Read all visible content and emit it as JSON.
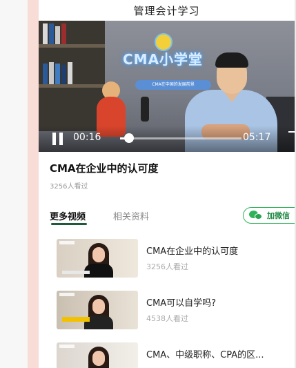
{
  "header": {
    "title": "管理会计学习"
  },
  "video": {
    "sign_text": "CMA小学堂",
    "sign_subtitle": "CMA在中国的发展前景",
    "current_time": "00:16",
    "total_time": "05:17",
    "progress_fraction": 0.05
  },
  "main": {
    "title": "CMA在企业中的认可度",
    "views": "3256人看过"
  },
  "tabs": [
    {
      "label": "更多视频",
      "active": true
    },
    {
      "label": "相关资料",
      "active": false
    }
  ],
  "wechat_button": {
    "label": "加微信"
  },
  "list": [
    {
      "title": "CMA在企业中的认可度",
      "views": "3256人看过"
    },
    {
      "title": "CMA可以自学吗?",
      "views": "4538人看过"
    },
    {
      "title": "CMA、中级职称、CPA的区...",
      "views": ""
    }
  ],
  "colors": {
    "accent_green": "#2fb35a",
    "side_stripe": "#f8dcd6",
    "tab_underline": "#1e5a3a"
  }
}
